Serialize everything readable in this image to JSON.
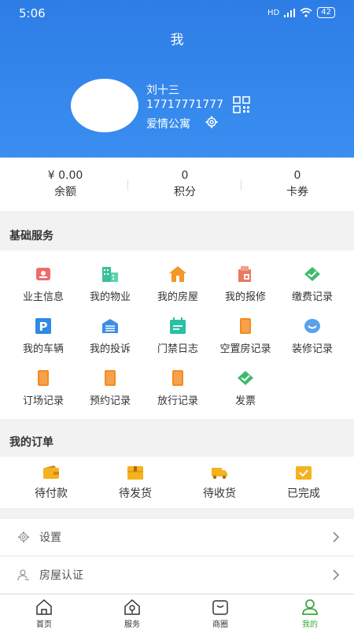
{
  "status": {
    "time": "5:06",
    "network": "HD",
    "battery": "42"
  },
  "page": {
    "title": "我"
  },
  "user": {
    "name": "刘十三",
    "phone": "17717771777",
    "community": "爱情公寓"
  },
  "stats": [
    {
      "value": "¥ 0.00",
      "label": "余额"
    },
    {
      "value": "0",
      "label": "积分"
    },
    {
      "value": "0",
      "label": "卡券"
    }
  ],
  "basic_services": {
    "title": "基础服务",
    "items": [
      {
        "label": "业主信息",
        "icon": "owner-info-icon",
        "color": "#f06a6a"
      },
      {
        "label": "我的物业",
        "icon": "property-building-icon",
        "color": "#3cbf9a"
      },
      {
        "label": "我的房屋",
        "icon": "house-icon",
        "color": "#f5962a"
      },
      {
        "label": "我的报修",
        "icon": "repair-icon",
        "color": "#e87a5d"
      },
      {
        "label": "缴费记录",
        "icon": "payment-record-icon",
        "color": "#3dbb6a"
      },
      {
        "label": "我的车辆",
        "icon": "parking-icon",
        "color": "#2d8ae6"
      },
      {
        "label": "我的投诉",
        "icon": "complaint-icon",
        "color": "#3a8ee6"
      },
      {
        "label": "门禁日志",
        "icon": "access-log-icon",
        "color": "#2bbfa5"
      },
      {
        "label": "空置房记录",
        "icon": "vacant-house-icon",
        "color": "#f58a1f"
      },
      {
        "label": "装修记录",
        "icon": "decoration-record-icon",
        "color": "#5aa0ee"
      },
      {
        "label": "订场记录",
        "icon": "venue-booking-icon",
        "color": "#f58a1f"
      },
      {
        "label": "预约记录",
        "icon": "appointment-icon",
        "color": "#f58a1f"
      },
      {
        "label": "放行记录",
        "icon": "release-record-icon",
        "color": "#f58a1f"
      },
      {
        "label": "发票",
        "icon": "invoice-icon",
        "color": "#3dbb6a"
      }
    ]
  },
  "orders": {
    "title": "我的订单",
    "items": [
      {
        "label": "待付款",
        "icon": "wallet-icon"
      },
      {
        "label": "待发货",
        "icon": "package-icon"
      },
      {
        "label": "待收货",
        "icon": "truck-icon"
      },
      {
        "label": "已完成",
        "icon": "completed-box-icon"
      }
    ]
  },
  "settings_rows": [
    {
      "label": "设置",
      "icon": "gear-icon"
    },
    {
      "label": "房屋认证",
      "icon": "person-verify-icon"
    }
  ],
  "tabs": [
    {
      "label": "首页",
      "icon": "home-icon"
    },
    {
      "label": "服务",
      "icon": "service-icon"
    },
    {
      "label": "商圈",
      "icon": "shop-icon"
    },
    {
      "label": "我的",
      "icon": "profile-icon",
      "active": true
    }
  ],
  "colors": {
    "header": "#3a8ef0",
    "active_tab": "#3aa93a",
    "order_icon": "#f5b21f"
  }
}
